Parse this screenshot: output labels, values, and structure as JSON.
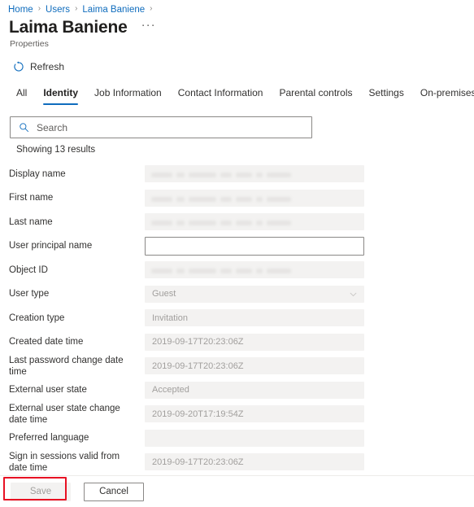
{
  "breadcrumb": {
    "items": [
      "Home",
      "Users",
      "Laima Baniene"
    ],
    "separator": "›",
    "trailing_separator": "›"
  },
  "header": {
    "title": "Laima Baniene",
    "subtitle": "Properties",
    "more_label": "···",
    "more_icon": "ellipsis-icon"
  },
  "commandbar": {
    "refresh_label": "Refresh",
    "refresh_icon": "refresh-icon",
    "accent_color": "#0f6cbd"
  },
  "tabs": {
    "active": "Identity",
    "items": [
      {
        "label": "All"
      },
      {
        "label": "Identity"
      },
      {
        "label": "Job Information"
      },
      {
        "label": "Contact Information"
      },
      {
        "label": "Parental controls"
      },
      {
        "label": "Settings"
      },
      {
        "label": "On-premises"
      }
    ]
  },
  "search": {
    "placeholder": "Search",
    "value": "",
    "icon": "search-icon"
  },
  "results": {
    "count_label": "Showing 13 results"
  },
  "form": {
    "fields": [
      {
        "label": "Display name",
        "value": "",
        "state": "redacted",
        "type": "text"
      },
      {
        "label": "First name",
        "value": "",
        "state": "redacted",
        "type": "text"
      },
      {
        "label": "Last name",
        "value": "",
        "state": "redacted",
        "type": "text"
      },
      {
        "label": "User principal name",
        "value": "",
        "state": "editable",
        "type": "text"
      },
      {
        "label": "Object ID",
        "value": "",
        "state": "redacted",
        "type": "text"
      },
      {
        "label": "User type",
        "value": "Guest",
        "state": "disabled",
        "type": "select"
      },
      {
        "label": "Creation type",
        "value": "Invitation",
        "state": "disabled",
        "type": "text"
      },
      {
        "label": "Created date time",
        "value": "2019-09-17T20:23:06Z",
        "state": "disabled",
        "type": "text"
      },
      {
        "label": "Last password change date time",
        "value": "2019-09-17T20:23:06Z",
        "state": "disabled",
        "type": "text"
      },
      {
        "label": "External user state",
        "value": "Accepted",
        "state": "disabled",
        "type": "text"
      },
      {
        "label": "External user state change date time",
        "value": "2019-09-20T17:19:54Z",
        "state": "disabled",
        "type": "text"
      },
      {
        "label": "Preferred language",
        "value": "",
        "state": "disabled",
        "type": "text"
      },
      {
        "label": "Sign in sessions valid from date time",
        "value": "2019-09-17T20:23:06Z",
        "state": "disabled",
        "type": "text"
      }
    ]
  },
  "footer": {
    "save_label": "Save",
    "save_disabled": true,
    "cancel_label": "Cancel",
    "highlight_color": "#e81123"
  }
}
